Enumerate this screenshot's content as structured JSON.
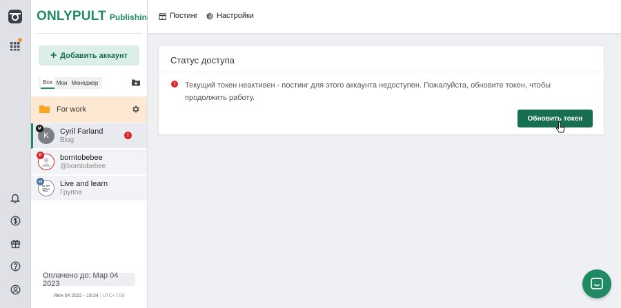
{
  "brand": {
    "name": "ONLYPULT",
    "sub": "Publishing"
  },
  "sidebar": {
    "add_account_label": "Добавить аккаунт",
    "filters": [
      {
        "label": "Все",
        "active": true
      },
      {
        "label": "Мои",
        "active": false
      },
      {
        "label": "Менеджер",
        "active": false
      }
    ],
    "folder": {
      "label": "For work"
    },
    "accounts": [
      {
        "name": "Cyril Farland",
        "sub": "Blog",
        "avatar_letter": "K",
        "network": "M",
        "warning": "!"
      },
      {
        "name": "borntobebee",
        "sub": "@borntobebee",
        "network": "P"
      },
      {
        "name": "Live and learn",
        "sub": "Группа",
        "network": "vk"
      }
    ],
    "paid_until": "Оплачено до: Мар 04 2023",
    "time": "Июн 04 2022 - 19:34",
    "timezone": "UTC+7:00"
  },
  "topbar": {
    "tabs": [
      {
        "label": "Постинг",
        "icon": "calendar-icon"
      },
      {
        "label": "Настройки",
        "icon": "gear-icon"
      }
    ]
  },
  "card": {
    "title": "Статус доступа",
    "message": "Текущий токен неактивен - постинг для этого аккаунта недоступен. Пожалуйста, обновите токен, чтобы продолжить работу.",
    "button_label": "Обновить токен",
    "error_mark": "!"
  },
  "colors": {
    "brand": "#1f8a63",
    "button": "#176f50",
    "folder_bg": "#fde8d4",
    "error": "#d9252a"
  }
}
